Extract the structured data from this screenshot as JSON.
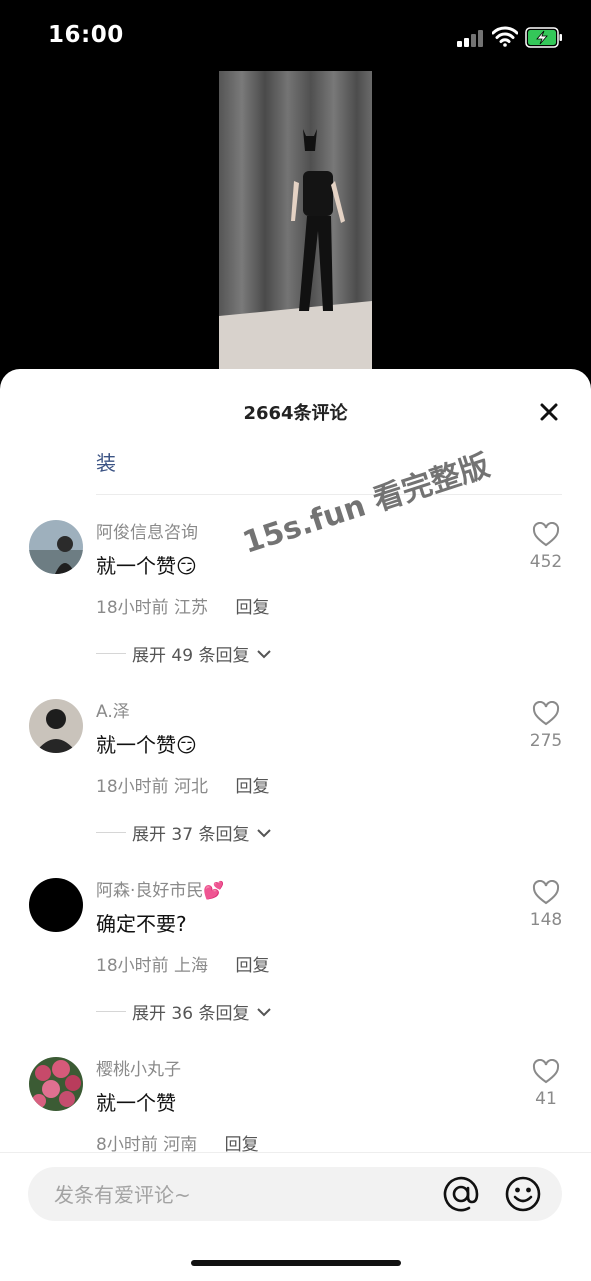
{
  "status": {
    "time": "16:00"
  },
  "comments_panel": {
    "title": "2664条评论",
    "pinned_text": "装",
    "comments": [
      {
        "user": "阿俊信息咨询",
        "text": "就一个赞",
        "emoji": "😏",
        "time": "18小时前",
        "location": "江苏",
        "reply": "回复",
        "expand": "展开 49 条回复",
        "likes": "452"
      },
      {
        "user": "A.泽",
        "text": "就一个赞",
        "emoji": "😏",
        "time": "18小时前",
        "location": "河北",
        "reply": "回复",
        "expand": "展开 37 条回复",
        "likes": "275"
      },
      {
        "user": "阿森·良好市民💕",
        "text": "确定不要?",
        "emoji": "",
        "time": "18小时前",
        "location": "上海",
        "reply": "回复",
        "expand": "展开 36 条回复",
        "likes": "148"
      },
      {
        "user": "樱桃小丸子",
        "text": "就一个赞",
        "emoji": "",
        "time": "8小时前",
        "location": "河南",
        "reply": "回复",
        "expand": "",
        "likes": "41"
      }
    ]
  },
  "watermark": "15s.fun 看完整版",
  "composer": {
    "placeholder": "发条有爱评论~"
  },
  "icons": {
    "close": "close-icon",
    "heart": "heart-icon",
    "at": "at-icon",
    "emoji": "emoji-icon",
    "chevron": "chevron-down-icon",
    "signal": "signal-icon",
    "wifi": "wifi-icon",
    "battery": "battery-charging-icon"
  },
  "colors": {
    "link": "#3b5384",
    "battery": "#34c759"
  }
}
